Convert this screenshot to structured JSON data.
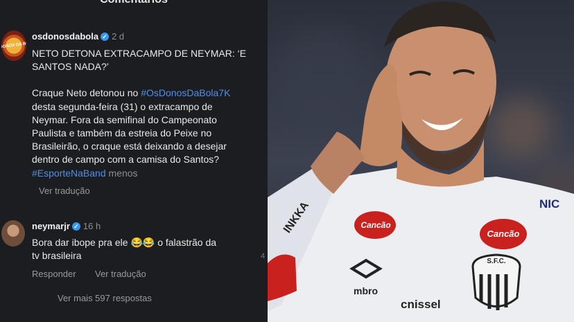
{
  "header": {
    "title": "Comentários"
  },
  "post": {
    "username": "osdonosdabola",
    "time": "2 d",
    "avatar_label": "OS DONOS DA BOLA",
    "headline_line1": "NETO DETONA EXTRACAMPO DE NEYMAR: ‘E",
    "headline_line2": "SANTOS NADA?’",
    "body_1a": "Craque Neto detonou no ",
    "hashtag_1": "#OsDonosDaBola7K",
    "body_2": "desta segunda-feira (31) o extracampo de",
    "body_3": "Neymar. Fora da semifinal do Campeonato",
    "body_4": "Paulista e também da estreia do Peixe no",
    "body_5": "Brasileirão, o craque está deixando a desejar",
    "body_6": "dentro de campo com a camisa do Santos?",
    "hashtag_2": "#EsporteNaBand",
    "less": "menos",
    "translate": "Ver tradução"
  },
  "reply": {
    "username": "neymarjr",
    "time": "16 h",
    "text_1a": "Bora dar ibope pra ele ",
    "emoji": "😂😂",
    "text_1b": " o falastrão da",
    "text_2": "tv brasileira",
    "respond": "Responder",
    "translate": "Ver tradução",
    "more": "Ver mais 597 respostas"
  },
  "photo": {
    "sponsor": "Cancão",
    "crest": "S.F.C.",
    "kit_brand": "mbro",
    "shirt_sponsor": "cnissel",
    "sleeve_text": "INKKA",
    "right_text": "NIC"
  },
  "colors": {
    "hashtag": "#4f8fe6",
    "verified": "#3897f0",
    "panel_bg": "#1c1d21"
  }
}
